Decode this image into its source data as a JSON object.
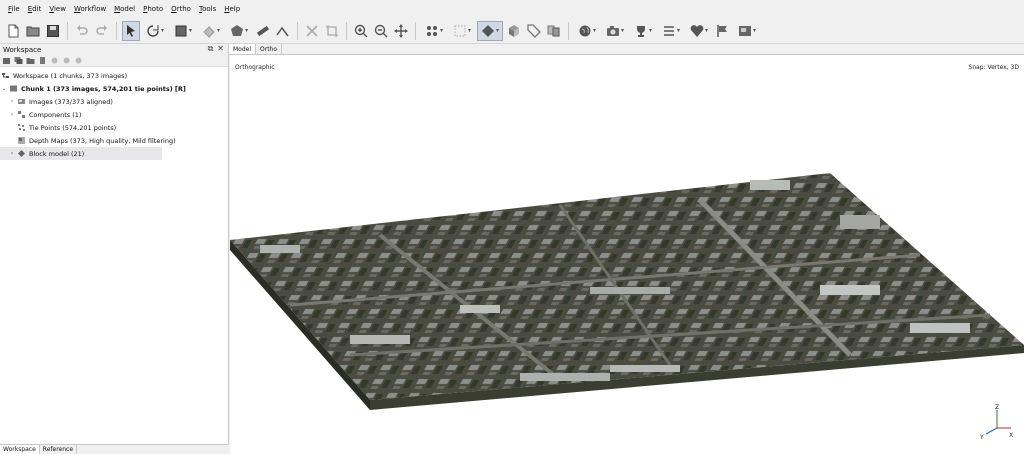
{
  "menu": [
    "File",
    "Edit",
    "View",
    "Workflow",
    "Model",
    "Photo",
    "Ortho",
    "Tools",
    "Help"
  ],
  "toolbar": {
    "icons": [
      "new-icon",
      "open-icon",
      "save-icon",
      "undo-icon",
      "redo-icon",
      "navigation-icon",
      "rotate-icon",
      "rectangle-selection-icon",
      "fill-icon",
      "polygon-icon",
      "ruler-icon",
      "draw-polyline-icon",
      "delete-icon",
      "crop-icon",
      "zoom-in-icon",
      "zoom-out-icon",
      "move-icon",
      "points-icon",
      "grid-points-icon",
      "model-view-icon",
      "texture-icon",
      "tag-icon",
      "compare-icon",
      "globe-icon",
      "camera-icon",
      "trophy-icon",
      "menu-icon",
      "shapes-icon",
      "flags-icon",
      "image-icon"
    ]
  },
  "workspace": {
    "panel_title": "Workspace",
    "root_label": "Workspace (1 chunks, 373 images)",
    "chunk_label": "Chunk 1 (373 images, 574,201 tie points) [R]",
    "items": [
      {
        "label": "Images (373/373 aligned)",
        "expandable": true,
        "icon": "images-icon"
      },
      {
        "label": "Components (1)",
        "expandable": true,
        "icon": "components-icon"
      },
      {
        "label": "Tie Points (574,201 points)",
        "expandable": false,
        "icon": "tie-points-icon"
      },
      {
        "label": "Depth Maps (373, High quality, Mild filtering)",
        "expandable": false,
        "icon": "depth-maps-icon"
      },
      {
        "label": "Block model (21)",
        "expandable": true,
        "icon": "block-model-icon"
      }
    ],
    "bottom_tabs": [
      "Workspace",
      "Reference"
    ],
    "active_bottom_tab": "Workspace"
  },
  "view": {
    "tabs": [
      "Model",
      "Ortho"
    ],
    "active_tab": "Model",
    "projection_label": "Orthographic",
    "snap_label": "Snap: Vertex, 3D",
    "axis_labels": {
      "x": "X",
      "y": "Y",
      "z": "Z"
    }
  }
}
